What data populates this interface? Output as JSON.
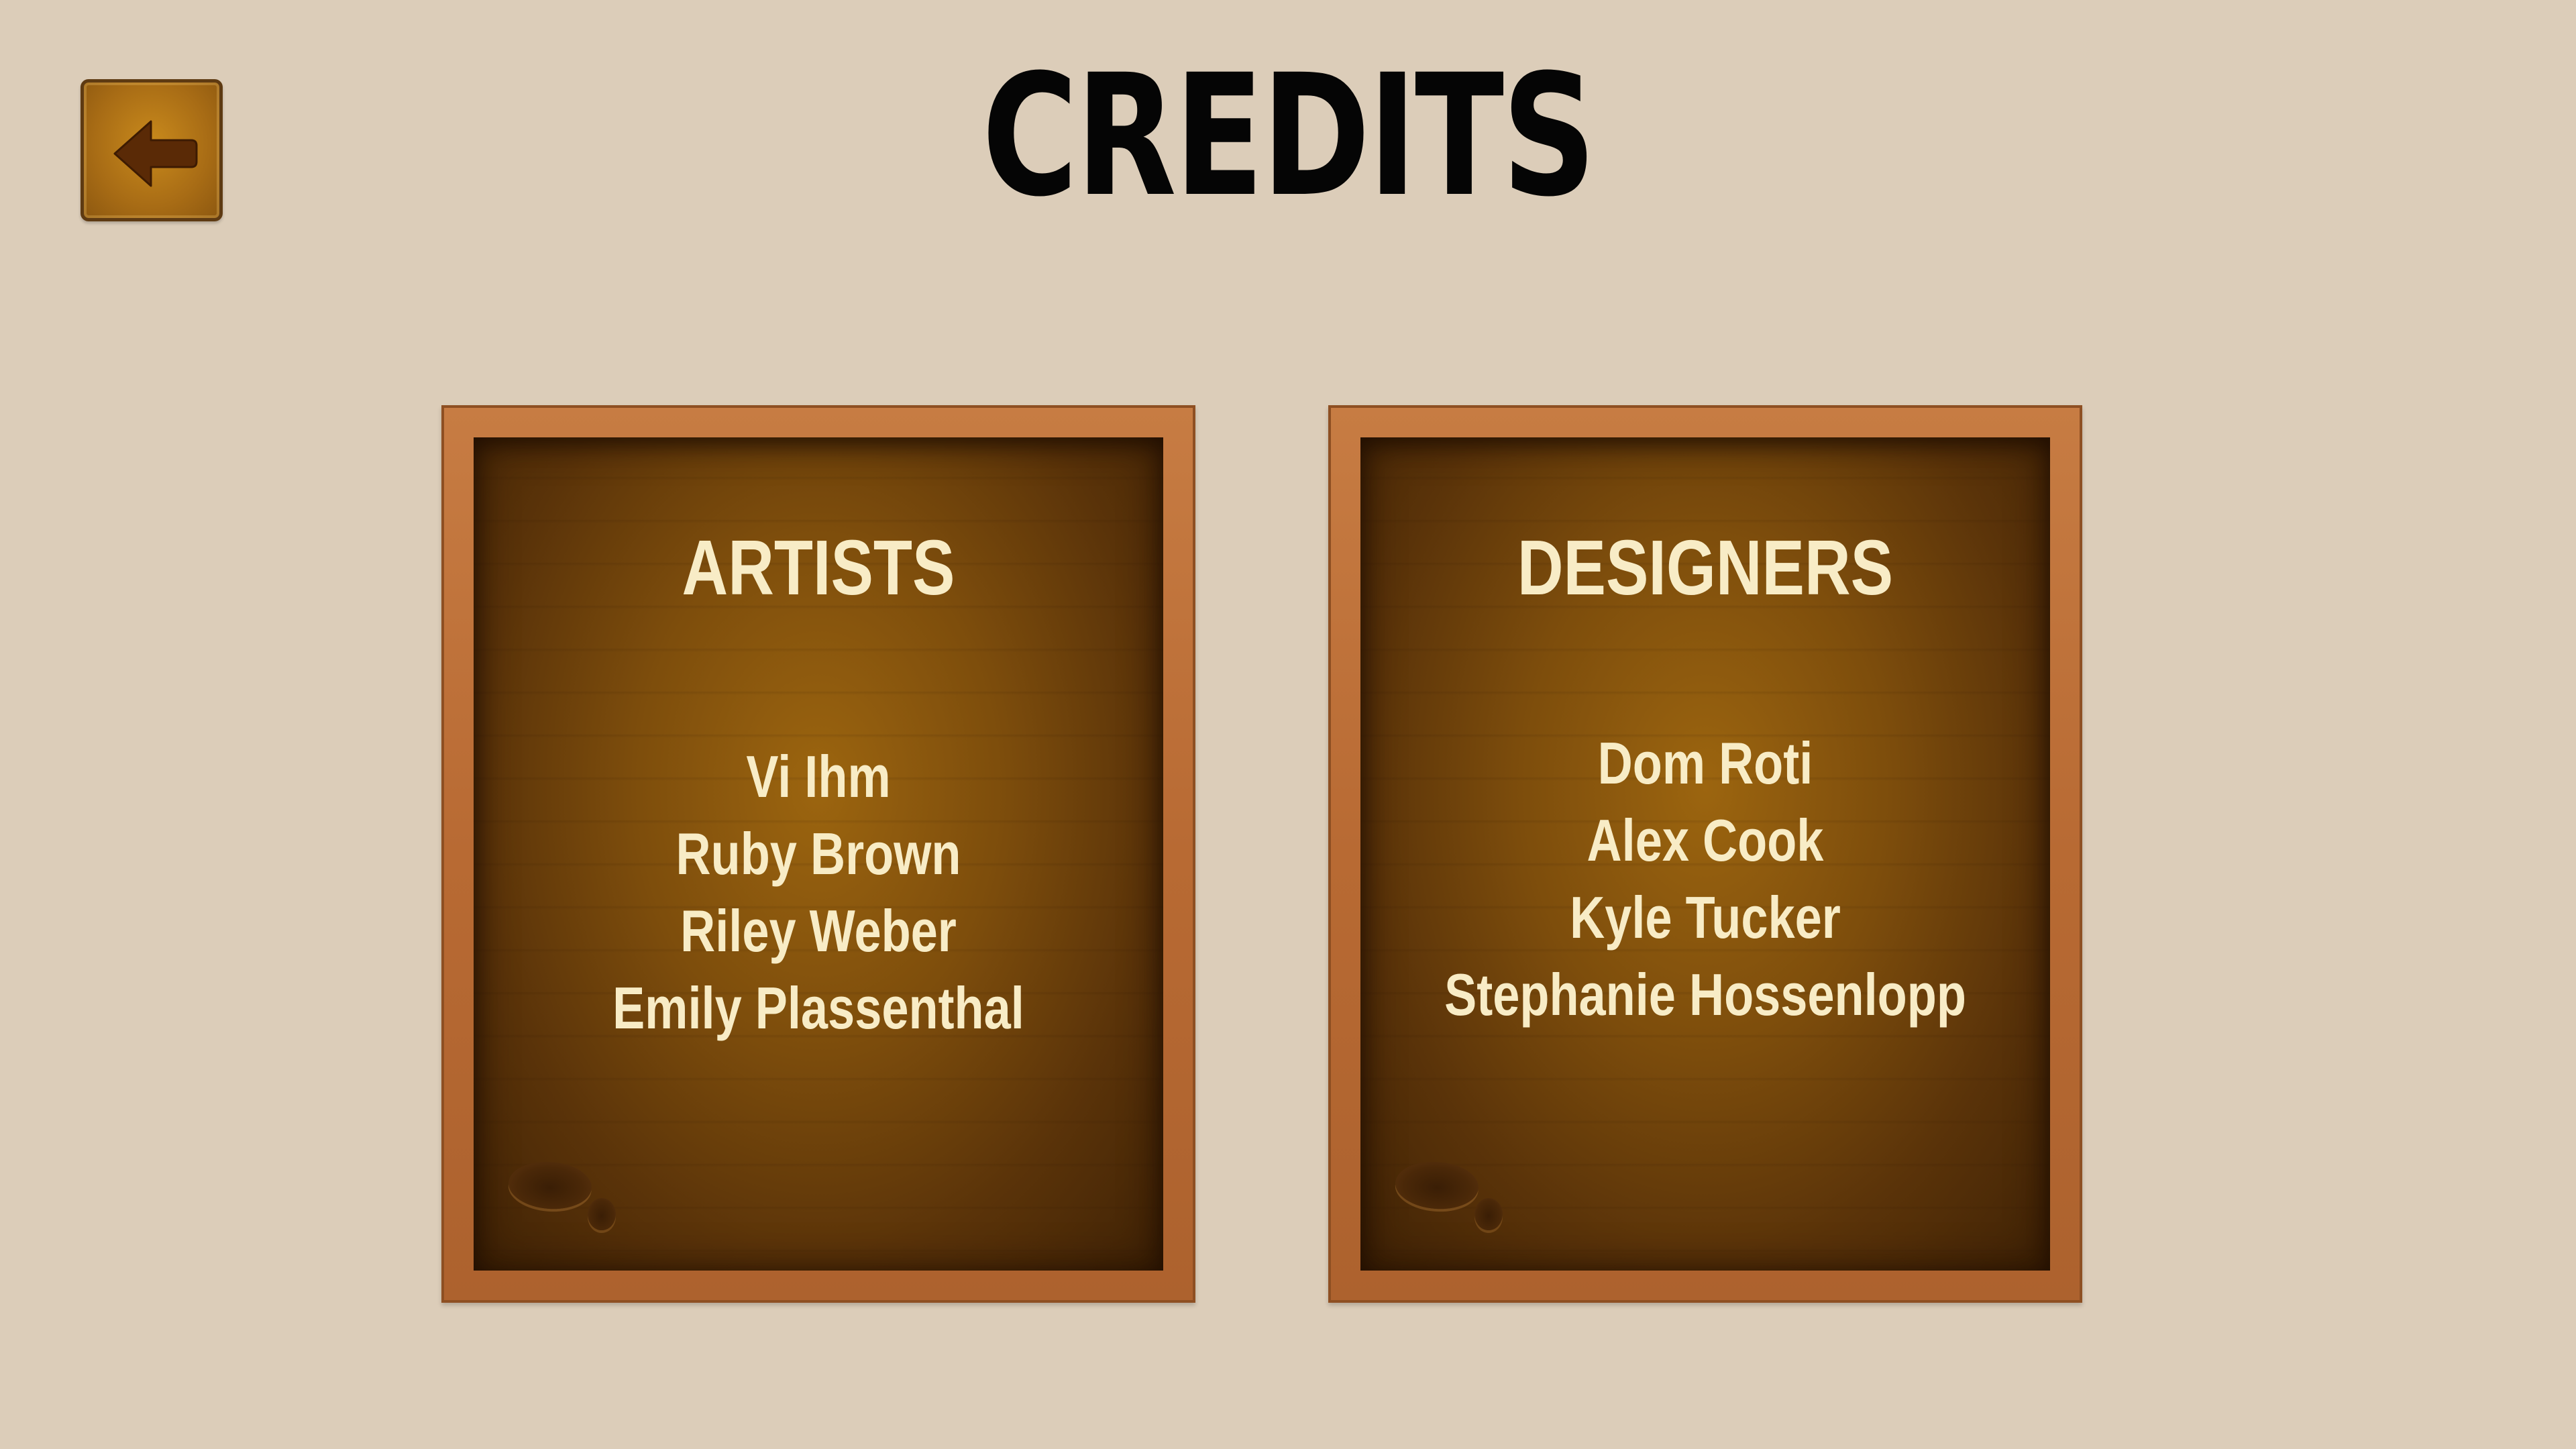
{
  "screen": {
    "title": "CREDITS",
    "background_color": "#dccdb9"
  },
  "back_button": {
    "icon": "arrow-left-icon",
    "color": "#a86c15"
  },
  "boards": {
    "artists": {
      "heading": "ARTISTS",
      "names": [
        "Vi Ihm",
        "Ruby Brown",
        "Riley Weber",
        "Emily Plassenthal"
      ]
    },
    "designers": {
      "heading": "DESIGNERS",
      "names": [
        "Dom Roti",
        "Alex Cook",
        "Kyle Tucker",
        "Stephanie Hossenlopp"
      ]
    }
  }
}
